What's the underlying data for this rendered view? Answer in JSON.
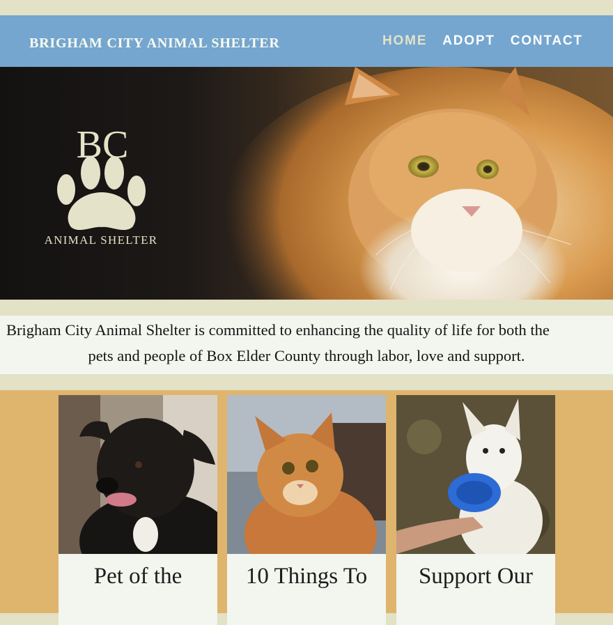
{
  "header": {
    "title": "BRIGHAM CITY ANIMAL SHELTER",
    "nav": [
      {
        "label": "HOME",
        "active": true
      },
      {
        "label": "ADOPT",
        "active": false
      },
      {
        "label": "CONTACT",
        "active": false
      }
    ]
  },
  "hero": {
    "logo_monogram": "BC",
    "logo_caption": "ANIMAL SHELTER",
    "image": "orange-longhair-cat-photo"
  },
  "mission": {
    "line1": "Brigham City Animal Shelter is committed to enhancing the quality of life for both the",
    "line2": "pets and people of Box Elder County through labor, love and support."
  },
  "cards": [
    {
      "title": "Pet of the",
      "image": "black-dog-photo"
    },
    {
      "title": "10 Things To",
      "image": "ginger-cat-photo"
    },
    {
      "title": "Support Our",
      "image": "white-dog-frisbee-photo"
    }
  ],
  "colors": {
    "header_bg": "#74a6cf",
    "page_bg": "#e3e1c6",
    "cards_bg": "#dfb46d",
    "panel_bg": "#f2f6ef",
    "nav_active": "#e4e2c8",
    "logo": "#e4e2c8"
  }
}
